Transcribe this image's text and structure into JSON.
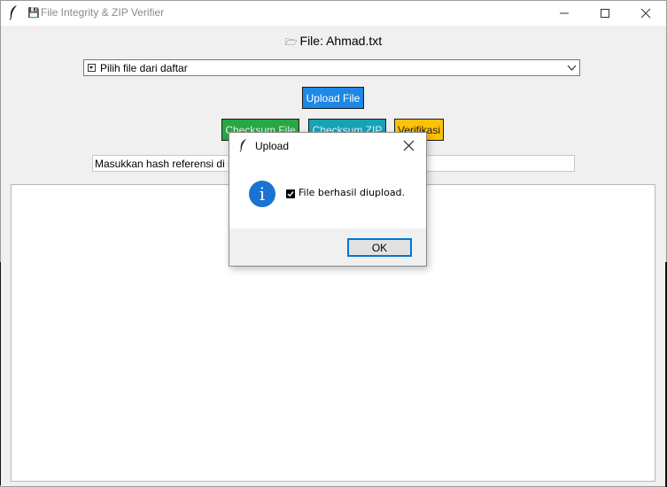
{
  "window": {
    "title": "File Integrity & ZIP Verifier",
    "title_icon": "lock-file-icon"
  },
  "file_label": {
    "icon": "folder-icon",
    "text": "File: Ahmad.txt"
  },
  "file_select": {
    "selected": "Pilih file dari daftar"
  },
  "buttons": {
    "upload": "Upload File",
    "checksum_file": "Checksum File",
    "checksum_zip": "Checksum ZIP",
    "verify": "Verifikasi"
  },
  "hash_entry": {
    "value": "Masukkan hash referensi di si"
  },
  "colors": {
    "upload": "#1e88e5",
    "checksum_file": "#28a745",
    "checksum_zip": "#17a2b8",
    "verify": "#ffc107",
    "info": "#1a73d0"
  },
  "dialog": {
    "title": "Upload",
    "message": "File berhasil diupload.",
    "ok_label": "OK",
    "icon": "info-icon"
  }
}
